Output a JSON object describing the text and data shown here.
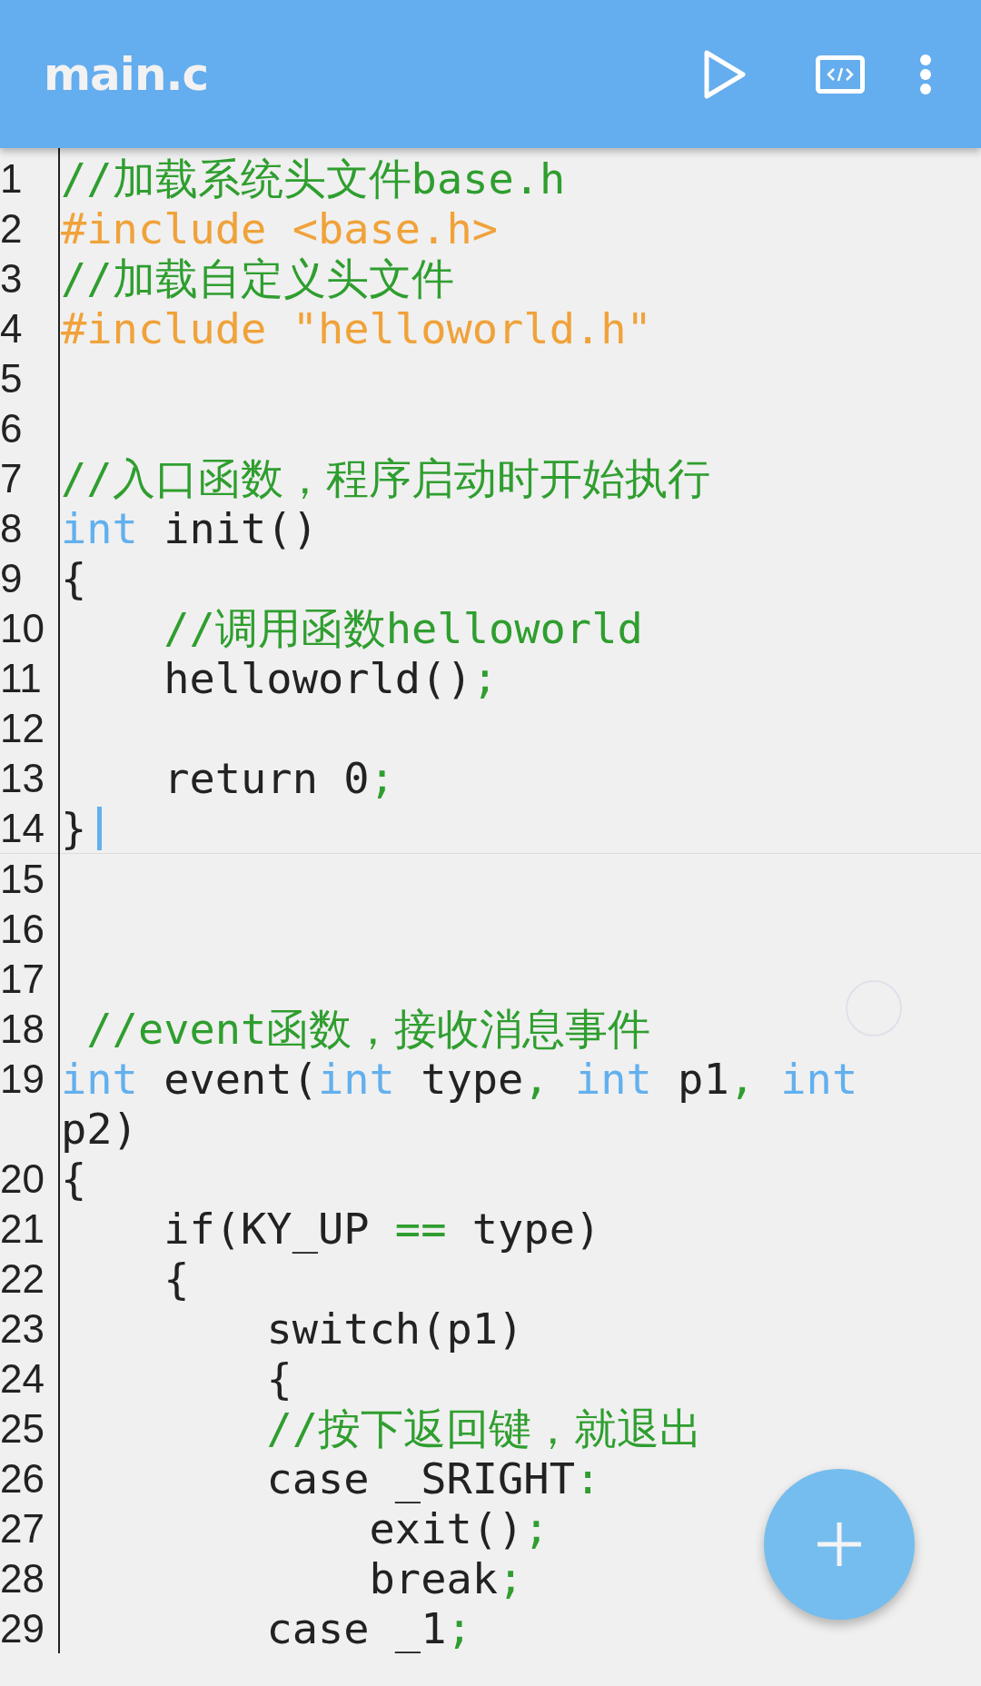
{
  "app_bar": {
    "title": "main.c"
  },
  "editor": {
    "lines": [
      {
        "number": "1",
        "current": false,
        "tokens": [
          {
            "kind": "comment",
            "text": "//加载系统头文件base.h"
          }
        ]
      },
      {
        "number": "2",
        "current": false,
        "tokens": [
          {
            "kind": "preproc",
            "text": "#include <base.h>"
          }
        ]
      },
      {
        "number": "3",
        "current": false,
        "tokens": [
          {
            "kind": "comment",
            "text": "//加载自定义头文件"
          }
        ]
      },
      {
        "number": "4",
        "current": false,
        "tokens": [
          {
            "kind": "preproc",
            "text": "#include \"helloworld.h\""
          }
        ]
      },
      {
        "number": "5",
        "current": false
      },
      {
        "number": "6",
        "current": false
      },
      {
        "number": "7",
        "current": false,
        "tokens": [
          {
            "kind": "comment",
            "text": "//入口函数，程序启动时开始执行"
          }
        ]
      },
      {
        "number": "8",
        "current": false,
        "tokens": [
          {
            "kind": "keyword",
            "text": "int"
          },
          {
            "kind": "plain",
            "text": " init()"
          }
        ]
      },
      {
        "number": "9",
        "current": false,
        "tokens": [
          {
            "kind": "plain",
            "text": "{"
          }
        ]
      },
      {
        "number": "10",
        "current": false,
        "tokens": [
          {
            "kind": "comment",
            "text": "    //调用函数helloworld"
          }
        ]
      },
      {
        "number": "11",
        "current": false,
        "tokens": [
          {
            "kind": "plain",
            "text": "    helloworld()"
          },
          {
            "kind": "punct",
            "text": ";"
          }
        ]
      },
      {
        "number": "12",
        "current": false
      },
      {
        "number": "13",
        "current": false,
        "tokens": [
          {
            "kind": "plain",
            "text": "    return 0"
          },
          {
            "kind": "punct",
            "text": ";"
          }
        ]
      },
      {
        "number": "14",
        "current": true,
        "tokens": [
          {
            "kind": "plain",
            "text": "}"
          }
        ]
      },
      {
        "number": "15",
        "current": false
      },
      {
        "number": "16",
        "current": false
      },
      {
        "number": "17",
        "current": false
      },
      {
        "number": "18",
        "current": false,
        "tokens": [
          {
            "kind": "comment",
            "text": " //event函数，接收消息事件"
          }
        ]
      },
      {
        "number": "19",
        "current": false,
        "tokens": [
          {
            "kind": "keyword",
            "text": "int"
          },
          {
            "kind": "plain",
            "text": " event("
          },
          {
            "kind": "keyword",
            "text": "int"
          },
          {
            "kind": "plain",
            "text": " type"
          },
          {
            "kind": "punct",
            "text": ","
          },
          {
            "kind": "keyword",
            "text": " int"
          },
          {
            "kind": "plain",
            "text": " p1"
          },
          {
            "kind": "punct",
            "text": ","
          },
          {
            "kind": "keyword",
            "text": " int"
          },
          {
            "kind": "plain",
            "text": " p2)"
          }
        ]
      },
      {
        "number": "20",
        "current": false,
        "tokens": [
          {
            "kind": "plain",
            "text": "{"
          }
        ]
      },
      {
        "number": "21",
        "current": false,
        "tokens": [
          {
            "kind": "plain",
            "text": "    if(KY_UP "
          },
          {
            "kind": "punct",
            "text": "=="
          },
          {
            "kind": "plain",
            "text": " type)"
          }
        ]
      },
      {
        "number": "22",
        "current": false,
        "tokens": [
          {
            "kind": "plain",
            "text": "    {"
          }
        ]
      },
      {
        "number": "23",
        "current": false,
        "tokens": [
          {
            "kind": "plain",
            "text": "        switch(p1)"
          }
        ]
      },
      {
        "number": "24",
        "current": false,
        "tokens": [
          {
            "kind": "plain",
            "text": "        {"
          }
        ]
      },
      {
        "number": "25",
        "current": false,
        "tokens": [
          {
            "kind": "comment",
            "text": "        //按下返回键，就退出"
          }
        ]
      },
      {
        "number": "26",
        "current": false,
        "tokens": [
          {
            "kind": "plain",
            "text": "        case _SRIGHT"
          },
          {
            "kind": "punct",
            "text": ":"
          }
        ]
      },
      {
        "number": "27",
        "current": false,
        "tokens": [
          {
            "kind": "plain",
            "text": "            exit()"
          },
          {
            "kind": "punct",
            "text": ";"
          }
        ]
      },
      {
        "number": "28",
        "current": false,
        "tokens": [
          {
            "kind": "plain",
            "text": "            break"
          },
          {
            "kind": "punct",
            "text": ";"
          }
        ]
      },
      {
        "number": "29",
        "current": false,
        "tokens": [
          {
            "kind": "plain",
            "text": "        case _1"
          },
          {
            "kind": "punct",
            "text": ";"
          }
        ]
      }
    ]
  }
}
